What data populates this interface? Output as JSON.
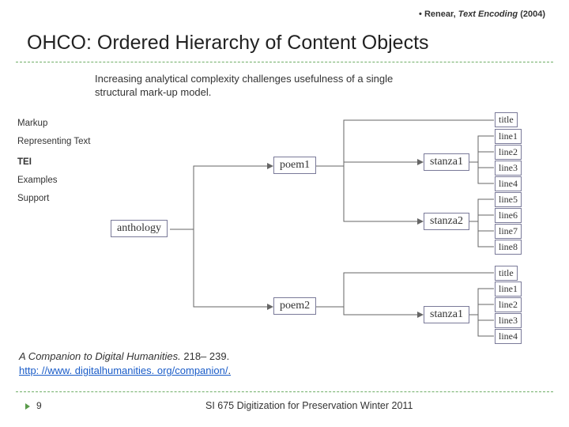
{
  "citation": {
    "bullet": "•",
    "author": "Renear,",
    "book": "Text Encoding",
    "year": "(2004)"
  },
  "title": "OHCO: Ordered Hierarchy of Content Objects",
  "summary": "Increasing analytical complexity challenges usefulness of a single structural mark-up model.",
  "sidebar": {
    "markup": "Markup",
    "reptext": "Representing Text",
    "tei": "TEI",
    "examples": "Examples",
    "support": "Support"
  },
  "diagram": {
    "anthology": "anthology",
    "poem1": "poem1",
    "poem2": "poem2",
    "title1": "title",
    "stanza1": "stanza1",
    "stanza2": "stanza2",
    "title2": "title",
    "stanza1b": "stanza1",
    "line1": "line1",
    "line2": "line2",
    "line3": "line3",
    "line4": "line4",
    "line5": "line5",
    "line6": "line6",
    "line7": "line7",
    "line8": "line8",
    "line1b": "line1",
    "line2b": "line2",
    "line3b": "line3",
    "line4b": "line4"
  },
  "reference": {
    "book": "A Companion to Digital Humanities.",
    "pages": "218– 239.",
    "url": "http: //www. digitalhumanities. org/companion/",
    "dot": "."
  },
  "footer": {
    "page": "9",
    "course": "SI 675 Digitization for Preservation   Winter 2011"
  }
}
